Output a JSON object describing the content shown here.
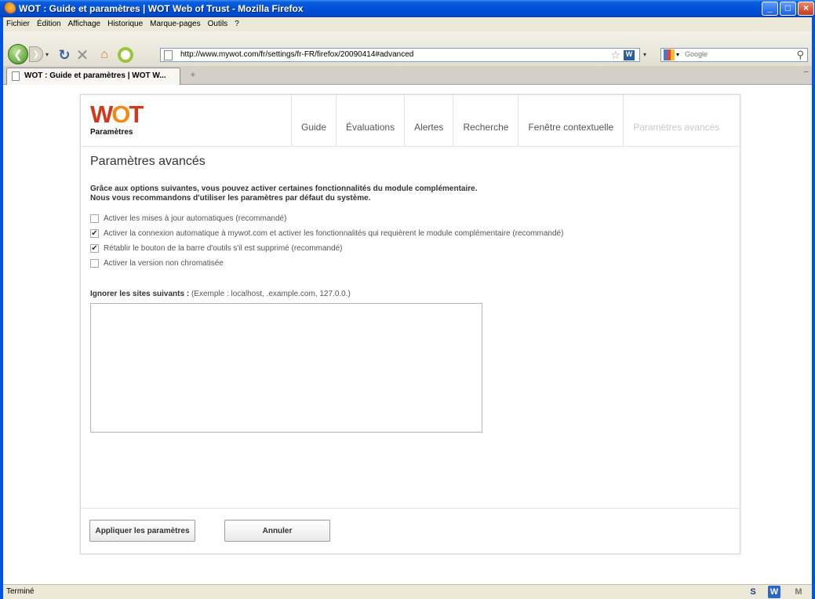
{
  "window": {
    "title": "WOT : Guide et paramètres | WOT Web of Trust - Mozilla Firefox"
  },
  "menu": [
    "Fichier",
    "Édition",
    "Affichage",
    "Historique",
    "Marque-pages",
    "Outils",
    "?"
  ],
  "nav": {
    "url": "http://www.mywot.com/fr/settings/fr-FR/firefox/20090414#advanced",
    "search_engine": "Google",
    "search_placeholder": "Google"
  },
  "tab": {
    "label": "WOT : Guide et paramètres | WOT W..."
  },
  "page": {
    "logo_text": "WOT",
    "logo_sub": "Paramètres",
    "tabs": [
      "Guide",
      "Évaluations",
      "Alertes",
      "Recherche",
      "Fenêtre contextuelle",
      "Paramètres avancés"
    ],
    "active_tab": "Paramètres avancés",
    "title": "Paramètres avancés",
    "description_line1": "Grâce aux options suivantes, vous pouvez activer certaines fonctionnalités du module complémentaire.",
    "description_line2": "Nous vous recommandons d'utiliser les paramètres par défaut du système.",
    "options": [
      {
        "label": "Activer les mises à jour automatiques (recommandé)",
        "checked": false
      },
      {
        "label": "Activer la connexion automatique à mywot.com et activer les fonctionnalités qui requièrent le module complémentaire (recommandé)",
        "checked": true
      },
      {
        "label": "Rétablir le bouton de la barre d'outils s'il est supprimé (recommandé)",
        "checked": true
      },
      {
        "label": "Activer la version non chromatisée",
        "checked": false
      }
    ],
    "ignore_label": "Ignorer les sites suivants :",
    "ignore_example": "(Exemple : localhost, .example.com, 127.0.0.)",
    "ignore_value": "",
    "apply_label": "Appliquer les paramètres",
    "cancel_label": "Annuler"
  },
  "status": {
    "text": "Terminé"
  },
  "icons": {
    "back": "back-arrow-icon",
    "reload": "reload-icon",
    "stop": "stop-icon",
    "home": "home-icon",
    "bookmark": "star-icon",
    "search": "magnifier-icon"
  },
  "colors": {
    "titlebar": "#0054e3",
    "logo_red": "#d03a1a",
    "logo_orange": "#f28a16"
  }
}
